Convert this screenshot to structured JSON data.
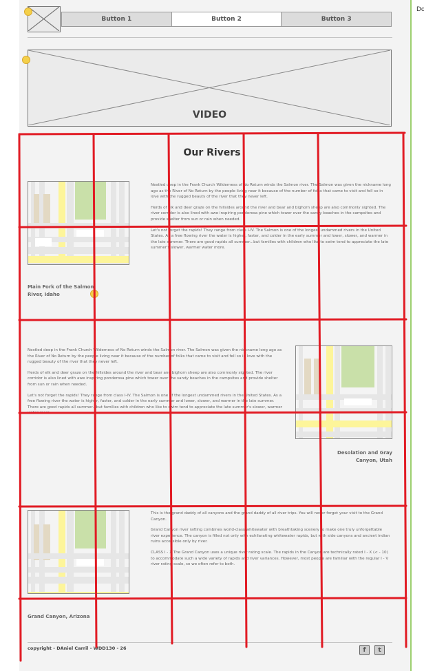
{
  "side_label": "Do",
  "nav": {
    "buttons": [
      {
        "label": "Button 1",
        "active": false
      },
      {
        "label": "Button 2",
        "active": true
      },
      {
        "label": "Button 3",
        "active": false
      }
    ]
  },
  "video": {
    "label": "VIDEO"
  },
  "rivers": {
    "title": "Our Rivers",
    "sections": [
      {
        "caption": "Main Fork of the Salmon River, Idaho",
        "paragraphs": [
          "Nestled deep in the Frank Church Wilderness of No Return winds the Salmon river. The Salmon was given the nickname long ago as the River of No Return by the people living near it because of the number of folks that came to visit and fell so in love with the rugged beauty of the river that they never left.",
          "Herds of elk and deer graze on the hillsides around the river and bear and bighorn sheep are also commonly sighted. The river corridor is also lined with awe inspiring ponderosa pine which tower over the sandy beaches in the campsites and provide shelter from sun or rain when needed.",
          "Let's not forget the rapids! They range from class I-IV. The Salmon is one of the longest undammed rivers in the United States. As a free flowing river the water is higher, faster, and colder in the early summer and lower, slower, and warmer in the late summer. There are good rapids all summer...but families with children who like to swim tend to appreciate the late summer's slower, warmer water more."
        ]
      },
      {
        "caption": "Desolation and Gray Canyon, Utah",
        "paragraphs": [
          "Nestled deep in the Frank Church Wilderness of No Return winds the Salmon river. The Salmon was given the nickname long ago as the River of No Return by the people living near it because of the number of folks that came to visit and fell so in love with the rugged beauty of the river that they never left.",
          "Herds of elk and deer graze on the hillsides around the river and bear and bighorn sheep are also commonly sighted. The river corridor is also lined with awe inspiring ponderosa pine which tower over the sandy beaches in the campsites and provide shelter from sun or rain when needed.",
          "Let's not forget the rapids! They range from class I-IV. The Salmon is one of the longest undammed rivers in the United States. As a free flowing river the water is higher, faster, and colder in the early summer and lower, slower, and warmer in the late summer. There are good rapids all summer...but families with children who like to swim tend to appreciate the late summer's slower, warmer water more."
        ]
      },
      {
        "caption": "Grand Canyon, Arizona",
        "paragraphs": [
          "This is the grand daddy of all canyons and the grand daddy of all river trips. You will never forget your visit to the Grand Canyon.",
          "Grand Canyon river rafting combines world-class whitewater with breathtaking scenery to make one truly unforgettable river experience. The canyon is filled not only with exhilarating whitewater rapids, but with side canyons and ancient indian ruins accessible only by river.",
          "CLASS I - X The Grand Canyon uses a unique river rating scale. The rapids in the Canyon are technically rated I - X (< - 10) to accommodate such a wide variety of rapids and river variances. However, most people are familiar with the regular I - V river rating scale, so we often refer to both."
        ]
      }
    ]
  },
  "footer": {
    "copyright": "copyright - DAniel Carril - WDD130 - 26",
    "social": [
      {
        "icon": "facebook-icon",
        "glyph": "f"
      },
      {
        "icon": "twitter-icon",
        "glyph": "t"
      }
    ]
  },
  "colors": {
    "grid_overlay": "#e11b24",
    "map_road": "#fdf59a",
    "map_park": "#c9e0a9",
    "map_block": "#e3d9c3",
    "map_street": "#e6e6e6",
    "marker": "#f4d04a",
    "sidebar_rail": "#9dcf6f"
  }
}
